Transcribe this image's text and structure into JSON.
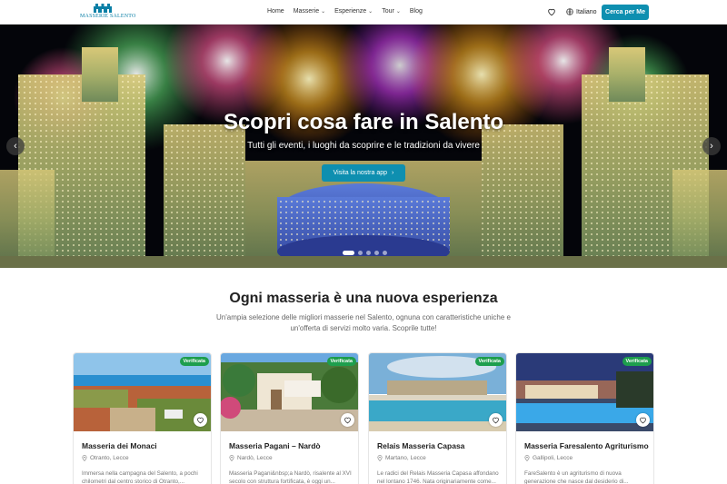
{
  "header": {
    "logo_text": "MASSERIE SALENTO",
    "nav": [
      {
        "label": "Home",
        "dropdown": false
      },
      {
        "label": "Masserie",
        "dropdown": true
      },
      {
        "label": "Esperienze",
        "dropdown": true
      },
      {
        "label": "Tour",
        "dropdown": true
      },
      {
        "label": "Blog",
        "dropdown": false
      }
    ],
    "favorites_icon": "heart-icon",
    "language_icon": "globe-icon",
    "language": "Italiano",
    "cta_label": "Cerca per Me"
  },
  "hero": {
    "title": "Scopri cosa fare in Salento",
    "subtitle": "Tutti gli eventi, i luoghi da scoprire e le tradizioni da vivere",
    "button_label": "Visita la nostra app",
    "button_icon": "chevron-right-icon",
    "prev_icon": "chevron-left-icon",
    "next_icon": "chevron-right-icon",
    "slides_count": 5,
    "active_slide": 1
  },
  "section": {
    "title": "Ogni masseria è una nuova esperienza",
    "description": "Un'ampia selezione delle migliori masserie nel Salento, ognuna con caratteristiche uniche e un'offerta di servizi molto varia. Scoprile tutte!"
  },
  "cards": [
    {
      "badge": "Verificata",
      "title": "Masseria dei Monaci",
      "location": "Otranto, Lecce",
      "description": "Immersa nella campagna del Salento, a pochi chilometri dal centro storico di Otranto,..."
    },
    {
      "badge": "Verificata",
      "title": "Masseria Pagani – Nardò",
      "location": "Nardò, Lecce",
      "description": "Masseria Pagani&nbsp;a Nardò, risalente al XVI secolo con struttura fortificata, è oggi un..."
    },
    {
      "badge": "Verificata",
      "title": "Relais Masseria Capasa",
      "location": "Martano, Lecce",
      "description": "Le radici del Relais Masseria Capasa affondano nel lontano 1746. Nata originariamente come..."
    },
    {
      "badge": "Verificata",
      "title": "Masseria Faresalento Agriturismo",
      "location": "Gallipoli, Lecce",
      "description": "FareSalento è un agriturismo di nuova generazione che nasce dal desiderio di..."
    }
  ],
  "colors": {
    "accent": "#0e8fb0",
    "badge": "#1e9e4d",
    "text": "#222222",
    "muted": "#777777"
  }
}
